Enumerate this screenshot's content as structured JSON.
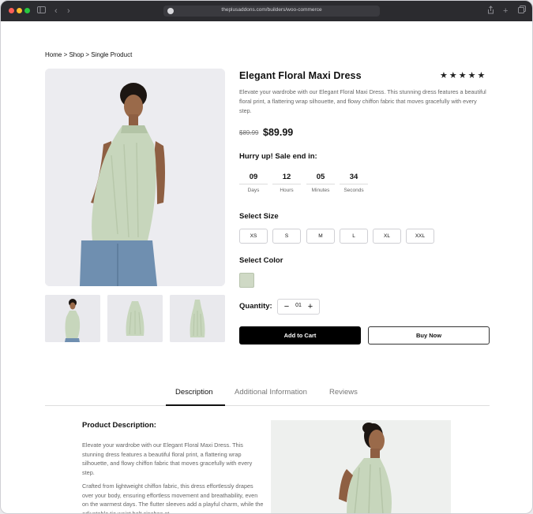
{
  "browser": {
    "url": "theplusaddons.com/builders/woo-commerce"
  },
  "breadcrumb": "Home > Shop > Single Product",
  "product": {
    "title": "Elegant Floral Maxi Dress",
    "stars": "★★★★★",
    "description": "Elevate your wardrobe with our Elegant Floral Maxi Dress. This stunning dress features a beautiful floral print, a flattering wrap silhouette, and flowy chiffon fabric that moves gracefully with every step.",
    "old_price": "$89.99",
    "new_price": "$89.99",
    "hurry": "Hurry up! Sale end in:",
    "countdown": [
      {
        "value": "09",
        "label": "Days"
      },
      {
        "value": "12",
        "label": "Hours"
      },
      {
        "value": "05",
        "label": "Minutes"
      },
      {
        "value": "34",
        "label": "Seconds"
      }
    ],
    "size_label": "Select Size",
    "sizes": [
      "XS",
      "S",
      "M",
      "L",
      "XL",
      "XXL"
    ],
    "color_label": "Select Color",
    "color_swatch": "#cfd9c5",
    "quantity_label": "Quantity:",
    "quantity": "01",
    "add_to_cart": "Add to Cart",
    "buy_now": "Buy Now"
  },
  "tabs": [
    "Description",
    "Additional Information",
    "Reviews"
  ],
  "description_section": {
    "title": "Product Description:",
    "para1": "Elevate your wardrobe with our Elegant Floral Maxi Dress. This stunning dress features a beautiful floral print, a flattering wrap silhouette, and flowy chiffon fabric that moves gracefully with every step.",
    "para2": "Crafted from lightweight chiffon fabric, this dress effortlessly drapes over your body, ensuring effortless movement and breathability, even on the warmest days. The flutter sleeves add a playful charm, while the adjustable tie waist belt cinches at"
  }
}
